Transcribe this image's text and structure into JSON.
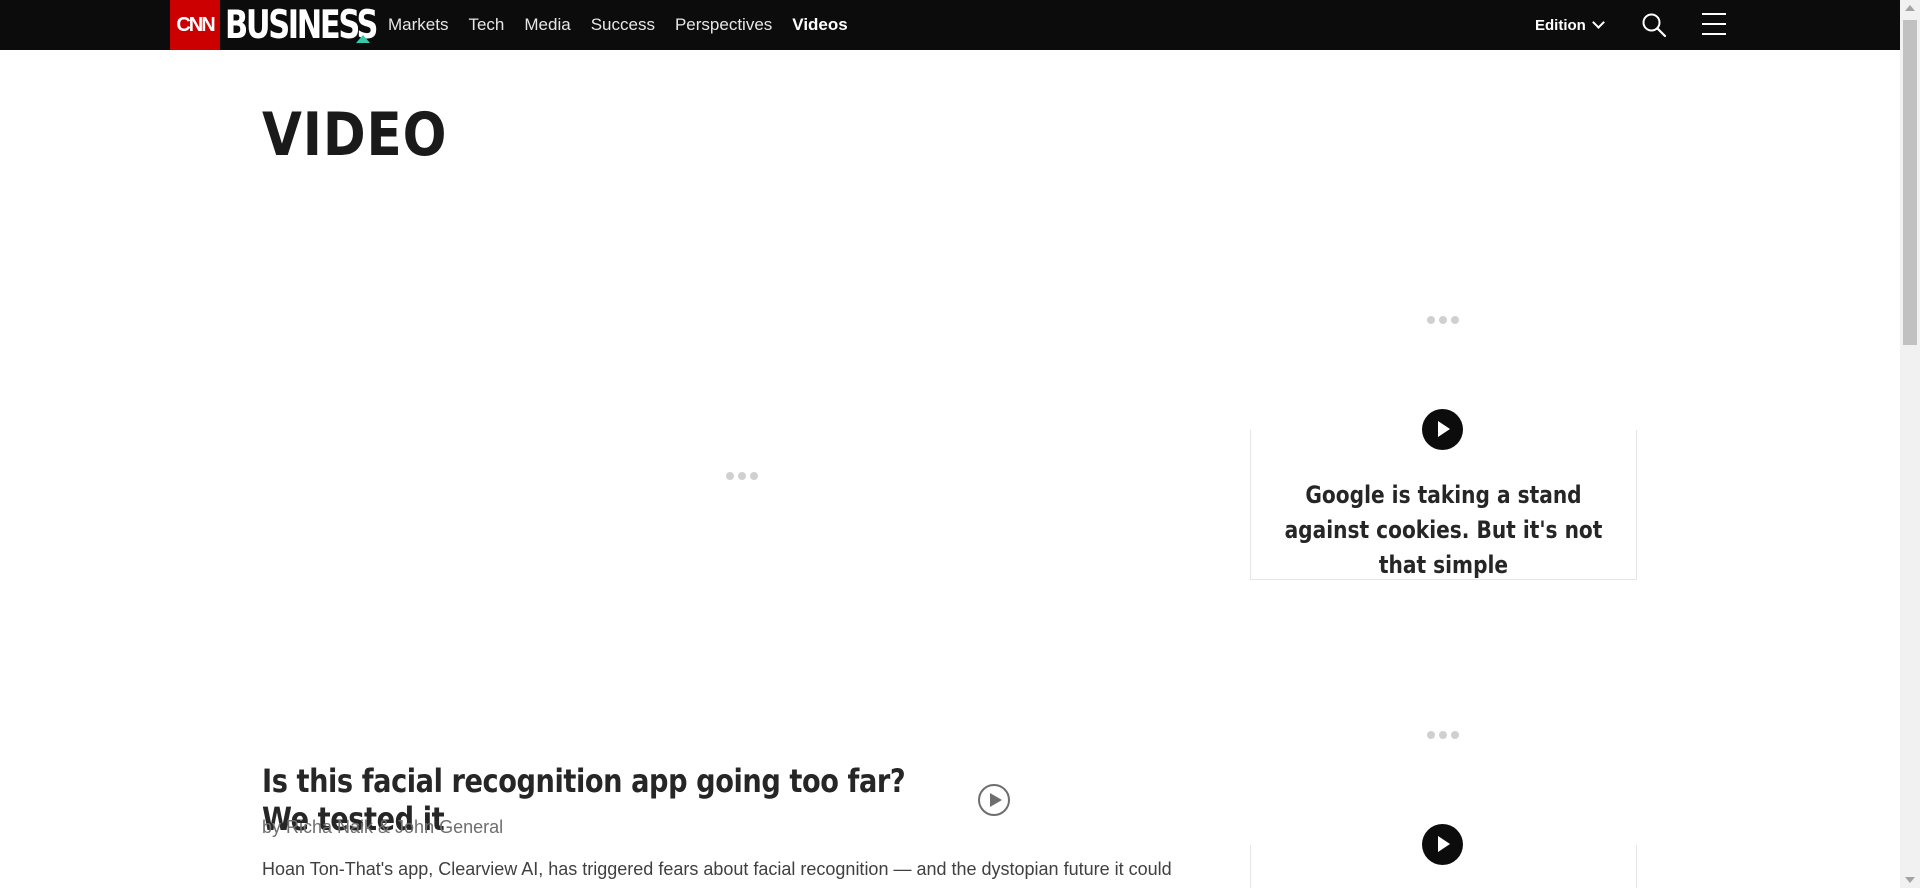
{
  "header": {
    "logo_cnn": "CNN",
    "logo_section": "BUSINESS",
    "nav": [
      {
        "label": "Markets"
      },
      {
        "label": "Tech"
      },
      {
        "label": "Media"
      },
      {
        "label": "Success"
      },
      {
        "label": "Perspectives"
      },
      {
        "label": "Videos",
        "active": true
      }
    ],
    "edition_label": "Edition",
    "icons": {
      "search": "search-icon",
      "menu": "hamburger-menu-icon",
      "edition_caret": "chevron-down-icon"
    }
  },
  "colors": {
    "header_bg": "#0c0c0c",
    "cnn_red": "#cc0000",
    "accent_triangle": "#33ccaa",
    "text_dark": "#262626",
    "text_muted": "#6e6e6e"
  },
  "main": {
    "page_title": "VIDEO",
    "featured_video": {
      "headline": "Is this facial recognition app going too far? We tested it",
      "byline": "by Richa Naik & John General",
      "summary": "Hoan Ton-That's app, Clearview AI, has triggered fears about facial recognition — and the dystopian future it could",
      "player_state": "loading"
    }
  },
  "sidebar": {
    "cards": [
      {
        "title": "Google is taking a stand against cookies. But it's not that simple",
        "state": "loading"
      },
      {
        "title": "",
        "state": "loading"
      }
    ]
  }
}
